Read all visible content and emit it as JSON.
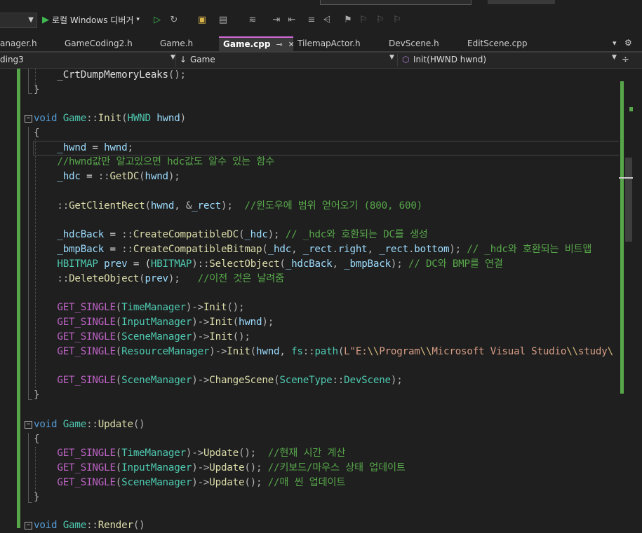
{
  "toolbar": {
    "run_label": "로컬 Windows 디버거",
    "run_dropdown": "▾"
  },
  "tabs": [
    {
      "label": "anager.h"
    },
    {
      "label": "GameCoding2.h"
    },
    {
      "label": "Game.h"
    },
    {
      "label": "Game.cpp",
      "active": true
    },
    {
      "label": "TilemapActor.h"
    },
    {
      "label": "DevScene.h"
    },
    {
      "label": "EditScene.cpp"
    }
  ],
  "navbar": {
    "project": "ding3",
    "scope": "Game",
    "member": "Init(HWND hwnd)"
  },
  "code": {
    "l1": [
      {
        "c": "w",
        "t": "    _CrtDumpMemoryLeaks"
      },
      {
        "c": "p",
        "t": "();"
      }
    ],
    "l2": [
      {
        "c": "p",
        "t": "}"
      }
    ],
    "l4": [
      {
        "c": "k",
        "t": "void"
      },
      {
        "c": "w",
        "t": " "
      },
      {
        "c": "t",
        "t": "Game"
      },
      {
        "c": "p",
        "t": "::"
      },
      {
        "c": "f",
        "t": "Init"
      },
      {
        "c": "p",
        "t": "("
      },
      {
        "c": "t",
        "t": "HWND"
      },
      {
        "c": "w",
        "t": " "
      },
      {
        "c": "v",
        "t": "hwnd"
      },
      {
        "c": "p",
        "t": ")"
      }
    ],
    "l5": [
      {
        "c": "p",
        "t": "{"
      }
    ],
    "l6": [
      {
        "c": "v",
        "t": "    _hwnd"
      },
      {
        "c": "w",
        "t": " = "
      },
      {
        "c": "v",
        "t": "hwnd"
      },
      {
        "c": "p",
        "t": ";"
      }
    ],
    "l7": [
      {
        "c": "c",
        "t": "    //hwnd값만 알고있으면 hdc값도 알수 있는 함수"
      }
    ],
    "l8": [
      {
        "c": "v",
        "t": "    _hdc"
      },
      {
        "c": "w",
        "t": " = "
      },
      {
        "c": "p",
        "t": "::"
      },
      {
        "c": "f",
        "t": "GetDC"
      },
      {
        "c": "p",
        "t": "("
      },
      {
        "c": "v",
        "t": "hwnd"
      },
      {
        "c": "p",
        "t": ");"
      }
    ],
    "l10": [
      {
        "c": "p",
        "t": "    ::"
      },
      {
        "c": "f",
        "t": "GetClientRect"
      },
      {
        "c": "p",
        "t": "("
      },
      {
        "c": "v",
        "t": "hwnd"
      },
      {
        "c": "p",
        "t": ", &"
      },
      {
        "c": "v",
        "t": "_rect"
      },
      {
        "c": "p",
        "t": ");  "
      },
      {
        "c": "c",
        "t": "//윈도우에 범위 얻어오기 (800, 600)"
      }
    ],
    "l12": [
      {
        "c": "v",
        "t": "    _hdcBack"
      },
      {
        "c": "w",
        "t": " = "
      },
      {
        "c": "p",
        "t": "::"
      },
      {
        "c": "f",
        "t": "CreateCompatibleDC"
      },
      {
        "c": "p",
        "t": "("
      },
      {
        "c": "v",
        "t": "_hdc"
      },
      {
        "c": "p",
        "t": "); "
      },
      {
        "c": "c",
        "t": "// _hdc와 호환되는 DC를 생성"
      }
    ],
    "l13": [
      {
        "c": "v",
        "t": "    _bmpBack"
      },
      {
        "c": "w",
        "t": " = "
      },
      {
        "c": "p",
        "t": "::"
      },
      {
        "c": "f",
        "t": "CreateCompatibleBitmap"
      },
      {
        "c": "p",
        "t": "("
      },
      {
        "c": "v",
        "t": "_hdc"
      },
      {
        "c": "p",
        "t": ", "
      },
      {
        "c": "v",
        "t": "_rect"
      },
      {
        "c": "p",
        "t": "."
      },
      {
        "c": "v",
        "t": "right"
      },
      {
        "c": "p",
        "t": ", "
      },
      {
        "c": "v",
        "t": "_rect"
      },
      {
        "c": "p",
        "t": "."
      },
      {
        "c": "v",
        "t": "bottom"
      },
      {
        "c": "p",
        "t": "); "
      },
      {
        "c": "c",
        "t": "// _hdc와 호환되는 비트맵"
      }
    ],
    "l14": [
      {
        "c": "t",
        "t": "    HBITMAP"
      },
      {
        "c": "w",
        "t": " "
      },
      {
        "c": "v",
        "t": "prev"
      },
      {
        "c": "w",
        "t": " = ("
      },
      {
        "c": "t",
        "t": "HBITMAP"
      },
      {
        "c": "p",
        "t": ")::"
      },
      {
        "c": "f",
        "t": "SelectObject"
      },
      {
        "c": "p",
        "t": "("
      },
      {
        "c": "v",
        "t": "_hdcBack"
      },
      {
        "c": "p",
        "t": ", "
      },
      {
        "c": "v",
        "t": "_bmpBack"
      },
      {
        "c": "p",
        "t": "); "
      },
      {
        "c": "c",
        "t": "// DC와 BMP를 연결"
      }
    ],
    "l15": [
      {
        "c": "p",
        "t": "    ::"
      },
      {
        "c": "f",
        "t": "DeleteObject"
      },
      {
        "c": "p",
        "t": "("
      },
      {
        "c": "v",
        "t": "prev"
      },
      {
        "c": "p",
        "t": ");   "
      },
      {
        "c": "c",
        "t": "//이전 것은 날려줌"
      }
    ],
    "l17": [
      {
        "c": "m",
        "t": "    GET_SINGLE"
      },
      {
        "c": "p",
        "t": "("
      },
      {
        "c": "t",
        "t": "TimeManager"
      },
      {
        "c": "p",
        "t": ")->"
      },
      {
        "c": "f",
        "t": "Init"
      },
      {
        "c": "p",
        "t": "();"
      }
    ],
    "l18": [
      {
        "c": "m",
        "t": "    GET_SINGLE"
      },
      {
        "c": "p",
        "t": "("
      },
      {
        "c": "t",
        "t": "InputManager"
      },
      {
        "c": "p",
        "t": ")->"
      },
      {
        "c": "f",
        "t": "Init"
      },
      {
        "c": "p",
        "t": "("
      },
      {
        "c": "v",
        "t": "hwnd"
      },
      {
        "c": "p",
        "t": ");"
      }
    ],
    "l19": [
      {
        "c": "m",
        "t": "    GET_SINGLE"
      },
      {
        "c": "p",
        "t": "("
      },
      {
        "c": "t",
        "t": "SceneManager"
      },
      {
        "c": "p",
        "t": ")->"
      },
      {
        "c": "f",
        "t": "Init"
      },
      {
        "c": "p",
        "t": "();"
      }
    ],
    "l20": [
      {
        "c": "m",
        "t": "    GET_SINGLE"
      },
      {
        "c": "p",
        "t": "("
      },
      {
        "c": "t",
        "t": "ResourceManager"
      },
      {
        "c": "p",
        "t": ")->"
      },
      {
        "c": "f",
        "t": "Init"
      },
      {
        "c": "p",
        "t": "("
      },
      {
        "c": "v",
        "t": "hwnd"
      },
      {
        "c": "p",
        "t": ", "
      },
      {
        "c": "t",
        "t": "fs"
      },
      {
        "c": "p",
        "t": "::"
      },
      {
        "c": "t",
        "t": "path"
      },
      {
        "c": "p",
        "t": "("
      },
      {
        "c": "s",
        "t": "L\"E:"
      },
      {
        "c": "e",
        "t": "\\\\"
      },
      {
        "c": "s",
        "t": "Program"
      },
      {
        "c": "e",
        "t": "\\\\"
      },
      {
        "c": "s",
        "t": "Microsoft Visual Studio"
      },
      {
        "c": "e",
        "t": "\\\\"
      },
      {
        "c": "s",
        "t": "study"
      },
      {
        "c": "e",
        "t": "\\"
      }
    ],
    "l22": [
      {
        "c": "m",
        "t": "    GET_SINGLE"
      },
      {
        "c": "p",
        "t": "("
      },
      {
        "c": "t",
        "t": "SceneManager"
      },
      {
        "c": "p",
        "t": ")->"
      },
      {
        "c": "f",
        "t": "ChangeScene"
      },
      {
        "c": "p",
        "t": "("
      },
      {
        "c": "t",
        "t": "SceneType"
      },
      {
        "c": "p",
        "t": "::"
      },
      {
        "c": "t",
        "t": "DevScene"
      },
      {
        "c": "p",
        "t": ");"
      }
    ],
    "l23": [
      {
        "c": "p",
        "t": "}"
      }
    ],
    "l25": [
      {
        "c": "k",
        "t": "void"
      },
      {
        "c": "w",
        "t": " "
      },
      {
        "c": "t",
        "t": "Game"
      },
      {
        "c": "p",
        "t": "::"
      },
      {
        "c": "f",
        "t": "Update"
      },
      {
        "c": "p",
        "t": "()"
      }
    ],
    "l26": [
      {
        "c": "p",
        "t": "{"
      }
    ],
    "l27": [
      {
        "c": "m",
        "t": "    GET_SINGLE"
      },
      {
        "c": "p",
        "t": "("
      },
      {
        "c": "t",
        "t": "TimeManager"
      },
      {
        "c": "p",
        "t": ")->"
      },
      {
        "c": "f",
        "t": "Update"
      },
      {
        "c": "p",
        "t": "();  "
      },
      {
        "c": "c",
        "t": "//현재 시간 계산"
      }
    ],
    "l28": [
      {
        "c": "m",
        "t": "    GET_SINGLE"
      },
      {
        "c": "p",
        "t": "("
      },
      {
        "c": "t",
        "t": "InputManager"
      },
      {
        "c": "p",
        "t": ")->"
      },
      {
        "c": "f",
        "t": "Update"
      },
      {
        "c": "p",
        "t": "(); "
      },
      {
        "c": "c",
        "t": "//키보드/마우스 상태 업데이트"
      }
    ],
    "l29": [
      {
        "c": "m",
        "t": "    GET_SINGLE"
      },
      {
        "c": "p",
        "t": "("
      },
      {
        "c": "t",
        "t": "SceneManager"
      },
      {
        "c": "p",
        "t": ")->"
      },
      {
        "c": "f",
        "t": "Update"
      },
      {
        "c": "p",
        "t": "(); "
      },
      {
        "c": "c",
        "t": "//매 씬 업데이트"
      }
    ],
    "l30": [
      {
        "c": "p",
        "t": "}"
      }
    ],
    "l32": [
      {
        "c": "k",
        "t": "void"
      },
      {
        "c": "w",
        "t": " "
      },
      {
        "c": "t",
        "t": "Game"
      },
      {
        "c": "p",
        "t": "::"
      },
      {
        "c": "f",
        "t": "Render"
      },
      {
        "c": "p",
        "t": "()"
      }
    ]
  }
}
